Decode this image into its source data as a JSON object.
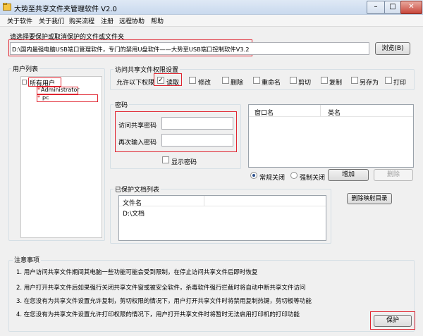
{
  "window": {
    "title": "大势至共享文件夹管理软件 V2.0",
    "minimize": "–",
    "maximize": "□",
    "close": "✕"
  },
  "menu": [
    "关于软件",
    "关于我们",
    "购买流程",
    "注册",
    "远程协助",
    "帮助"
  ],
  "path_section": {
    "label": "请选择要保护或取消保护的文件或文件夹",
    "value": "D:\\国内最强电脑USB端口管理软件，专门的禁用U盘软件——大势至USB端口控制软件V3.2",
    "browse_button": "浏览(B)"
  },
  "users": {
    "group_title": "用户列表",
    "root": "所有用户",
    "children": [
      "Administrator",
      "pc"
    ]
  },
  "permissions": {
    "group_title": "访问共享文件权限设置",
    "allow_label": "允许以下权限",
    "items": [
      {
        "label": "读取",
        "checked": true
      },
      {
        "label": "修改",
        "checked": false
      },
      {
        "label": "删除",
        "checked": false
      },
      {
        "label": "重命名",
        "checked": false
      },
      {
        "label": "剪切",
        "checked": false
      },
      {
        "label": "复制",
        "checked": false
      },
      {
        "label": "另存为",
        "checked": false
      },
      {
        "label": "打印",
        "checked": false
      }
    ]
  },
  "password": {
    "group_title": "密码",
    "access_label": "访问共享密码",
    "confirm_label": "再次输入密码",
    "access_value": "",
    "confirm_value": "",
    "show_label": "显示密码"
  },
  "window_list": {
    "col_window": "窗口名",
    "col_class": "类名"
  },
  "close_mode": {
    "normal": "常规关闭",
    "force": "强制关闭",
    "selected": "normal",
    "add_button": "增加",
    "delete_button": "删除"
  },
  "protected_docs": {
    "group_title": "已保护文档列表",
    "column": "文件名",
    "rows": [
      "D:\\文档"
    ],
    "delete_mapping_button": "删除映射目录"
  },
  "notes": {
    "group_title": "注意事项",
    "items": [
      "1. 用户访问共享文件期间其电脑一些功能可能会受到限制，在停止访问共享文件后即时恢复",
      "2. 用户打开共享文件后如果强行关闭共享文件窗或被安全软件，杀毒软件强行拦截时将自动中断共享文件访问",
      "3. 在您没有为共享文件设置允许复制，剪切权限的情况下，用户打开共享文件时将禁用复制热键，剪切板等功能",
      "4. 在您没有为共享文件设置允许打印权限的情况下，用户打开共享文件时将暂时无法启用打印机的打印功能"
    ]
  },
  "protect_button": "保护"
}
